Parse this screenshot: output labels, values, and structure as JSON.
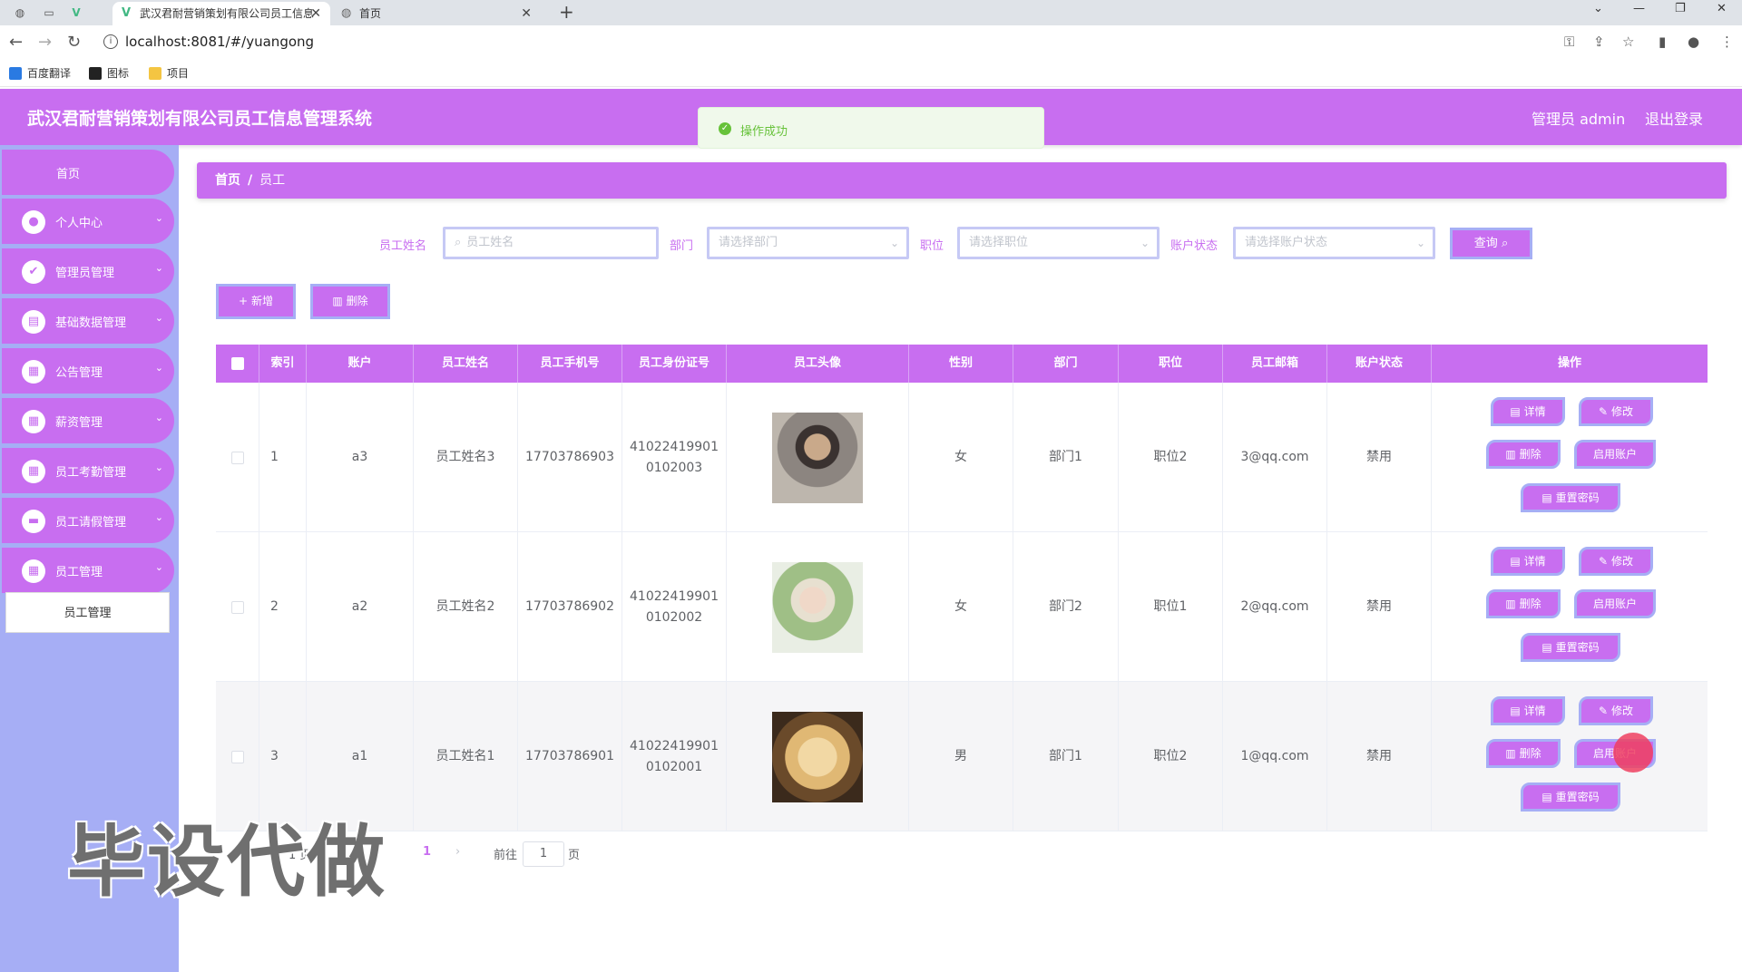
{
  "browser": {
    "tabs": [
      {
        "title": "武汉君耐营销策划有限公司员工信息",
        "active": true
      },
      {
        "title": "首页",
        "active": false
      }
    ],
    "url": "localhost:8081/#/yuangong",
    "bookmarks": [
      "百度翻译",
      "图标",
      "项目"
    ]
  },
  "header": {
    "title": "武汉君耐营销策划有限公司员工信息管理系统",
    "user": "管理员 admin",
    "logout": "退出登录"
  },
  "toast": {
    "text": "操作成功"
  },
  "sidebar": {
    "home": "首页",
    "items": [
      {
        "label": "个人中心",
        "icon": "user-icon"
      },
      {
        "label": "管理员管理",
        "icon": "admin-icon"
      },
      {
        "label": "基础数据管理",
        "icon": "data-icon"
      },
      {
        "label": "公告管理",
        "icon": "grid-icon"
      },
      {
        "label": "薪资管理",
        "icon": "grid-icon"
      },
      {
        "label": "员工考勤管理",
        "icon": "grid-icon"
      },
      {
        "label": "员工请假管理",
        "icon": "chat-icon"
      },
      {
        "label": "员工管理",
        "icon": "grid-icon"
      }
    ],
    "sub_item": "员工管理"
  },
  "breadcrumb": {
    "home": "首页",
    "current": "员工"
  },
  "filters": {
    "name_label": "员工姓名",
    "name_placeholder": "员工姓名",
    "dept_label": "部门",
    "dept_placeholder": "请选择部门",
    "pos_label": "职位",
    "pos_placeholder": "请选择职位",
    "status_label": "账户状态",
    "status_placeholder": "请选择账户状态",
    "query": "查询"
  },
  "toolbar": {
    "add": "新增",
    "delete": "删除"
  },
  "table": {
    "headers": [
      "索引",
      "账户",
      "员工姓名",
      "员工手机号",
      "员工身份证号",
      "员工头像",
      "性别",
      "部门",
      "职位",
      "员工邮箱",
      "账户状态",
      "操作"
    ],
    "rows": [
      {
        "index": "1",
        "account": "a3",
        "name": "员工姓名3",
        "phone": "17703786903",
        "id1": "41022419901",
        "id2": "0102003",
        "gender": "女",
        "dept": "部门1",
        "pos": "职位2",
        "email": "3@qq.com",
        "status": "禁用"
      },
      {
        "index": "2",
        "account": "a2",
        "name": "员工姓名2",
        "phone": "17703786902",
        "id1": "41022419901",
        "id2": "0102002",
        "gender": "女",
        "dept": "部门2",
        "pos": "职位1",
        "email": "2@qq.com",
        "status": "禁用"
      },
      {
        "index": "3",
        "account": "a1",
        "name": "员工姓名1",
        "phone": "17703786901",
        "id1": "41022419901",
        "id2": "0102001",
        "gender": "男",
        "dept": "部门1",
        "pos": "职位2",
        "email": "1@qq.com",
        "status": "禁用"
      }
    ],
    "actions": {
      "detail": "详情",
      "edit": "修改",
      "delete": "删除",
      "enable": "启用账户",
      "reset": "重置密码"
    }
  },
  "pagination": {
    "page_text": "1 页",
    "current": "1",
    "goto": "前往",
    "goto_value": "1",
    "suffix": "页"
  },
  "watermark": "毕设代做",
  "colors": {
    "accent": "#c86ef0",
    "sidebar": "#a6aef5",
    "success": "#67c23a"
  }
}
